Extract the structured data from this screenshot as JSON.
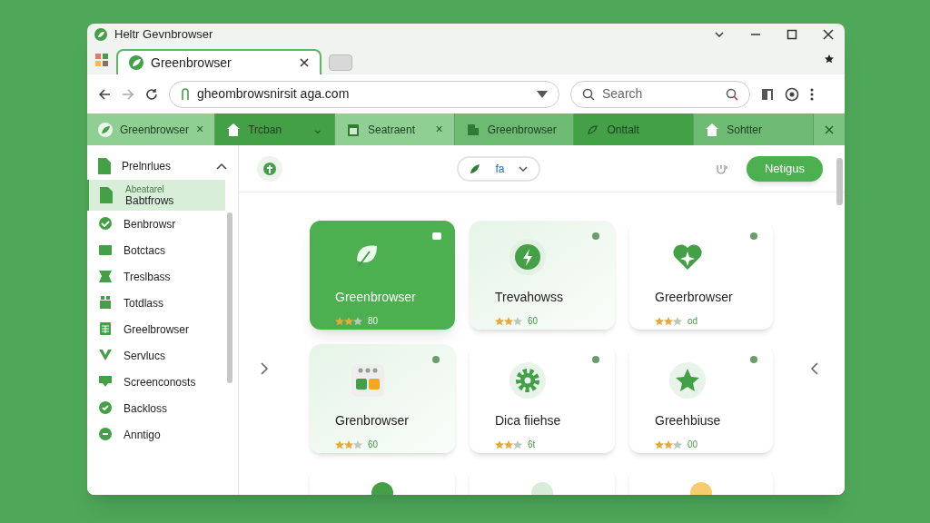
{
  "window": {
    "title": "Heltr Gevnbrowser"
  },
  "tabs": [
    {
      "label": "Greenbrowser",
      "selected": true
    }
  ],
  "address_bar": {
    "url": "gheombrowsnirsit aga.com"
  },
  "search": {
    "placeholder": "Search"
  },
  "bookmark_tabs": [
    {
      "label": "Greenbrowser",
      "color": "#8fcf94",
      "trailing": "×"
    },
    {
      "label": "Trcban",
      "color": "#43a047",
      "trailing": "⌄"
    },
    {
      "label": "Seatraent",
      "color": "#8fcf94",
      "trailing": "×"
    },
    {
      "label": "Greenbrowser",
      "color": "#6dbb72"
    },
    {
      "label": "Onttalt",
      "color": "#43a047"
    },
    {
      "label": "Sohtter",
      "color": "#6dbb72"
    }
  ],
  "sidebar": {
    "header": "Prelnrlues",
    "expanded": true,
    "items": [
      {
        "label": "Babtfrows",
        "sublabel": "Abeatarel",
        "selected": true
      },
      {
        "label": "Benbrowsr",
        "selected": false
      },
      {
        "label": "Botctacs",
        "selected": false
      },
      {
        "label": "Treslbass",
        "selected": false
      },
      {
        "label": "Totdlass",
        "selected": false
      },
      {
        "label": "Greelbrowser",
        "selected": false
      },
      {
        "label": "Servlucs",
        "selected": false
      },
      {
        "label": "Screenconosts",
        "selected": false
      },
      {
        "label": "Backloss",
        "selected": false
      },
      {
        "label": "Anntigo",
        "selected": false
      }
    ]
  },
  "toolbar": {
    "segment_text": "fa",
    "button": "Netigus"
  },
  "cards": [
    {
      "title": "Greenbrowser",
      "stars": 2,
      "rating": "80",
      "selected": true,
      "tinted": false
    },
    {
      "title": "Trevahowss",
      "stars": 2,
      "rating": "60",
      "selected": false,
      "tinted": true
    },
    {
      "title": "Greerbrowser",
      "stars": 2,
      "rating": "od",
      "selected": false,
      "tinted": false
    },
    {
      "title": "Grenbrowser",
      "stars": 2,
      "rating": "60",
      "selected": false,
      "tinted": true
    },
    {
      "title": "Dica fiiehse",
      "stars": 2,
      "rating": "6t",
      "selected": false,
      "tinted": false
    },
    {
      "title": "Greehbiuse",
      "stars": 2,
      "rating": "00",
      "selected": false,
      "tinted": false
    }
  ]
}
